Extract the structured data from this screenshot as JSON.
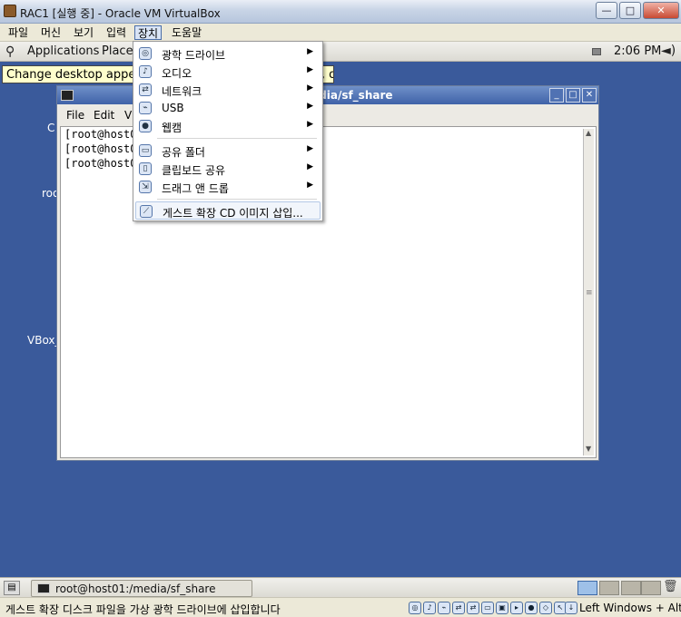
{
  "window": {
    "title": "RAC1 [실행 중] - Oracle VM VirtualBox",
    "min_symbol": "—",
    "max_symbol": "□",
    "close_symbol": "✕"
  },
  "menubar": {
    "items": [
      "파일",
      "머신",
      "보기",
      "입력",
      "장치",
      "도움말"
    ],
    "active": "장치"
  },
  "gnome_top": {
    "applications": "Applications",
    "places": "Places",
    "clock": "2:06 PM"
  },
  "tooltip": "Change desktop appearance and behaviour, get help, or log out",
  "desktop_labels": {
    "label1": "C",
    "label2": "roo",
    "label3": "VBox_"
  },
  "terminal": {
    "title": "edia/sf_share",
    "menu": [
      "File",
      "Edit",
      "V"
    ],
    "lines": [
      "[root@host0",
      "[root@host0",
      "[root@host0"
    ]
  },
  "device_menu": {
    "items": [
      {
        "label": "광학 드라이브",
        "icon": "optical-drive-icon",
        "submenu": true
      },
      {
        "label": "오디오",
        "icon": "audio-icon",
        "submenu": true
      },
      {
        "label": "네트워크",
        "icon": "network-icon",
        "submenu": true
      },
      {
        "label": "USB",
        "icon": "usb-icon",
        "submenu": true
      },
      {
        "label": "웹캠",
        "icon": "webcam-icon",
        "submenu": true
      },
      {
        "label": "공유 폴더",
        "icon": "shared-folder-icon",
        "submenu": true
      },
      {
        "label": "클립보드 공유",
        "icon": "clipboard-icon",
        "submenu": true
      },
      {
        "label": "드래그 앤 드롭",
        "icon": "drag-drop-icon",
        "submenu": true
      },
      {
        "label": "게스트 확장 CD 이미지 삽입...",
        "icon": "guest-additions-icon",
        "submenu": false
      }
    ]
  },
  "gnome_bottom": {
    "task_label": "root@host01:/media/sf_share"
  },
  "statusbar": {
    "text": "게스트 확장 디스크 파일을 가상 광학 드라이브에 삽입합니다",
    "host_key": "Left Windows + Alt"
  },
  "colors": {
    "desktop": "#3a5a9b",
    "titlebar_accent": "#3f62a8"
  }
}
